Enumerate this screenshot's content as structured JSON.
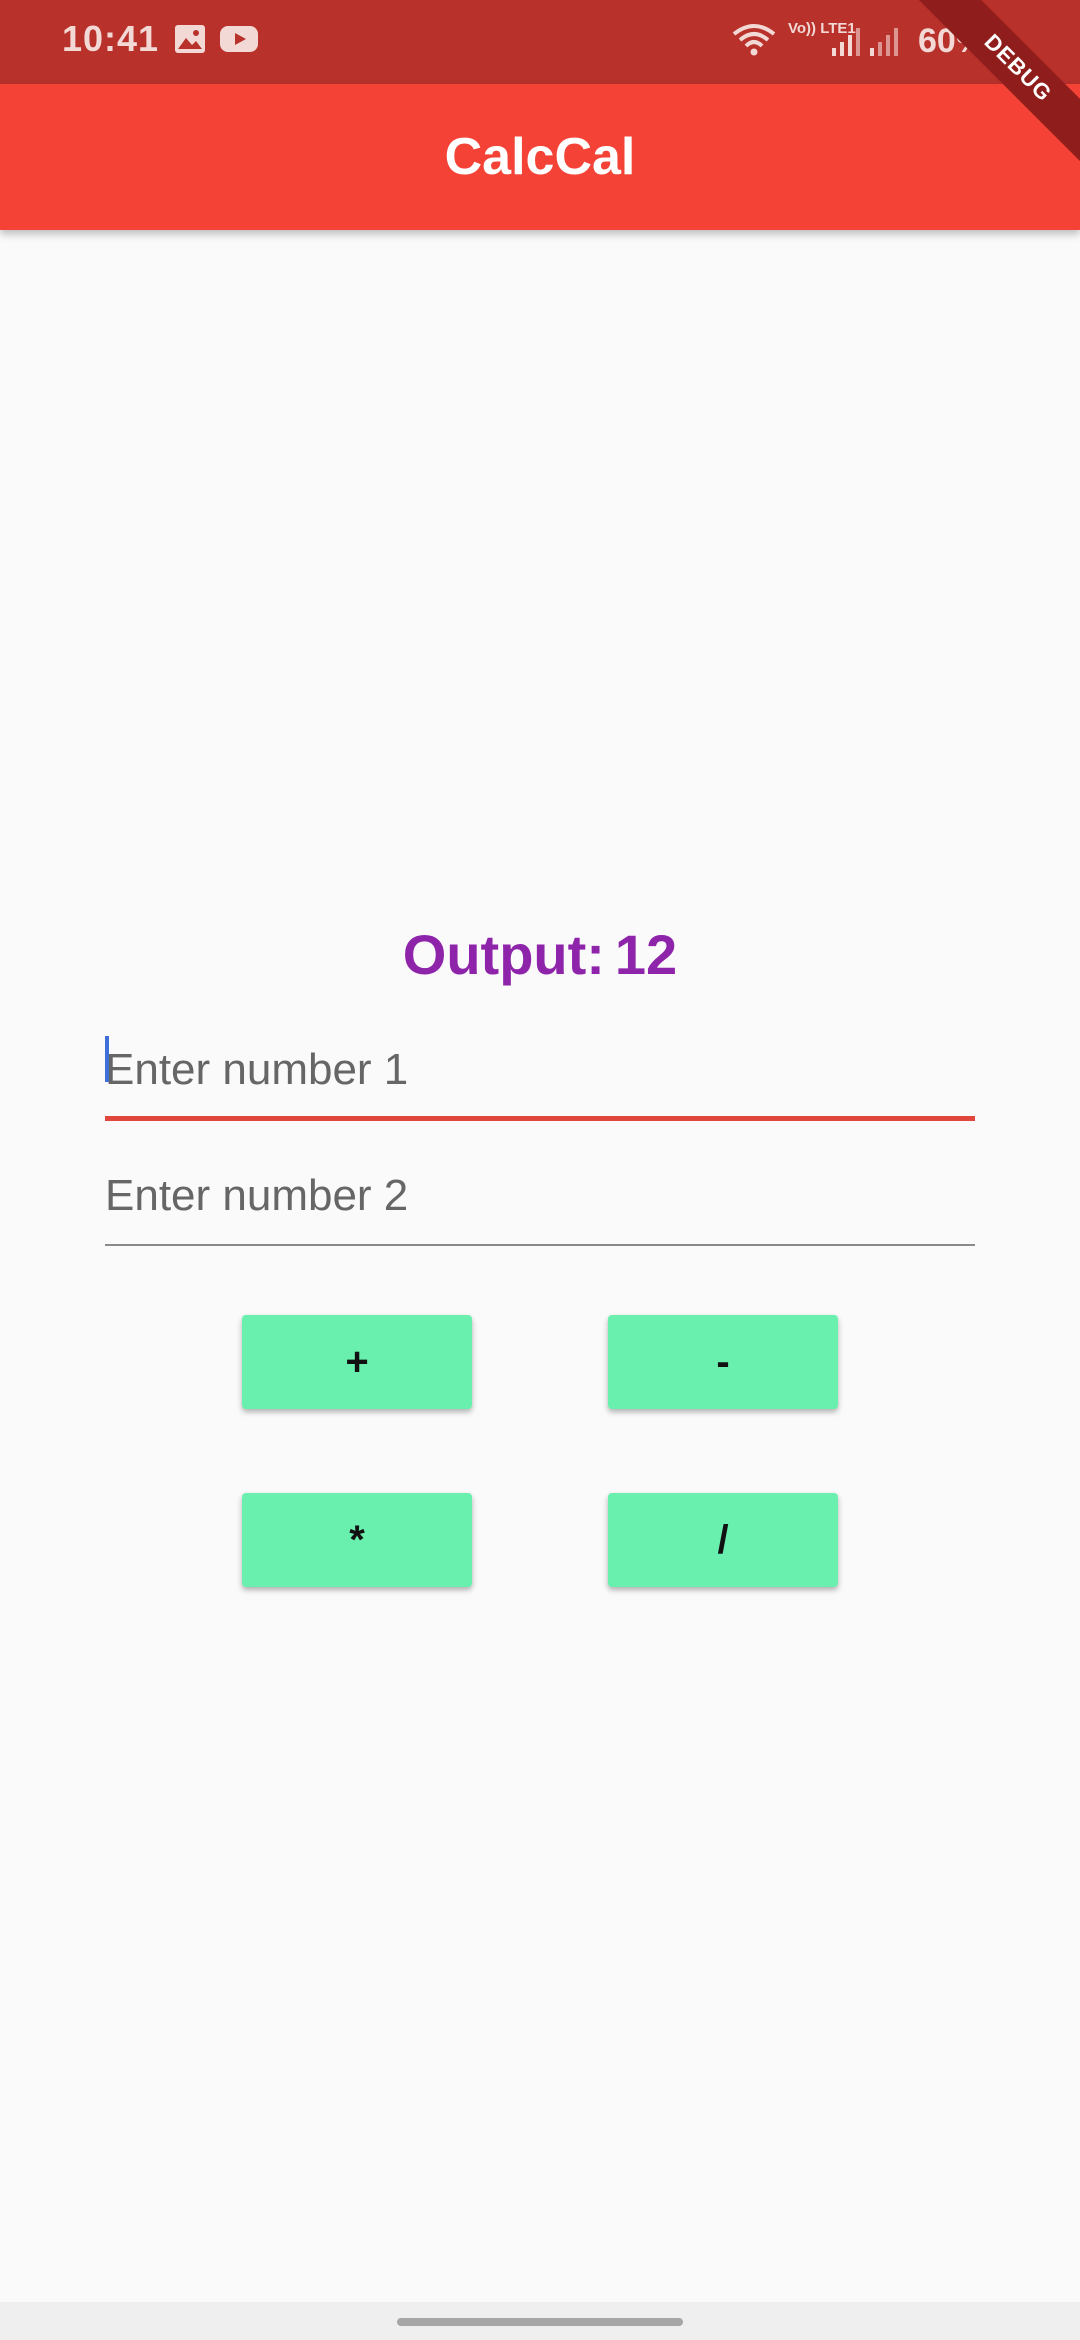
{
  "status_bar": {
    "time": "10:41",
    "volte": "Vo)) LTE1",
    "battery": "60%",
    "icons": [
      "gallery-icon",
      "youtube-icon",
      "wifi-icon",
      "signal-icon",
      "signal-icon"
    ]
  },
  "debug_banner": "DEBUG",
  "app_bar": {
    "title": "CalcCal",
    "color": "#f44336"
  },
  "output": {
    "label": "Output:",
    "value": "12",
    "color": "#8e24aa"
  },
  "inputs": {
    "number1": {
      "placeholder": "Enter number 1",
      "value": ""
    },
    "number2": {
      "placeholder": "Enter number 2",
      "value": ""
    }
  },
  "buttons": {
    "add": "+",
    "subtract": "-",
    "multiply": "*",
    "divide": "/",
    "color": "#69f0ae"
  }
}
